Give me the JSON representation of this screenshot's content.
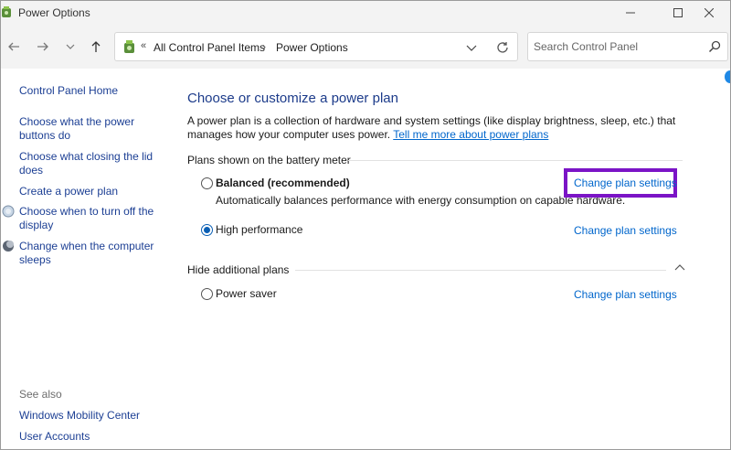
{
  "window": {
    "title": "Power Options",
    "controls": {
      "minimize": "–",
      "maximize": "☐",
      "close": "✕"
    }
  },
  "nav": {
    "back_icon": "arrow-left-icon",
    "forward_icon": "arrow-right-icon",
    "recent_icon": "chevron-down-icon",
    "up_icon": "arrow-up-icon",
    "address_chevron": "«",
    "breadcrumb": [
      "All Control Panel Items",
      "Power Options"
    ],
    "breadcrumb_separator": "›",
    "search_placeholder": "Search Control Panel"
  },
  "sidebar": {
    "home": "Control Panel Home",
    "links": [
      {
        "label": "Choose what the power buttons do"
      },
      {
        "label": "Choose what closing the lid does"
      },
      {
        "label": "Create a power plan"
      },
      {
        "label": "Choose when to turn off the display"
      },
      {
        "label": "Change when the computer sleeps"
      }
    ],
    "see_also_label": "See also",
    "see_also": [
      "Windows Mobility Center",
      "User Accounts"
    ]
  },
  "main": {
    "title": "Choose or customize a power plan",
    "description": "A power plan is a collection of hardware and system settings (like display brightness, sleep, etc.) that manages how your computer uses power.",
    "learn_more": "Tell me more about power plans",
    "battery_group_label": "Plans shown on the battery meter",
    "additional_group_label": "Hide additional plans",
    "plans": [
      {
        "name": "Balanced (recommended)",
        "description": "Automatically balances performance with energy consumption on capable hardware.",
        "selected": false,
        "link": "Change plan settings"
      },
      {
        "name": "High performance",
        "selected": true,
        "link": "Change plan settings"
      },
      {
        "name": "Power saver",
        "selected": false,
        "link": "Change plan settings"
      }
    ]
  },
  "colors": {
    "highlight_border": "#7b14c6",
    "link": "#0066cc",
    "title": "#1c3b8a"
  }
}
